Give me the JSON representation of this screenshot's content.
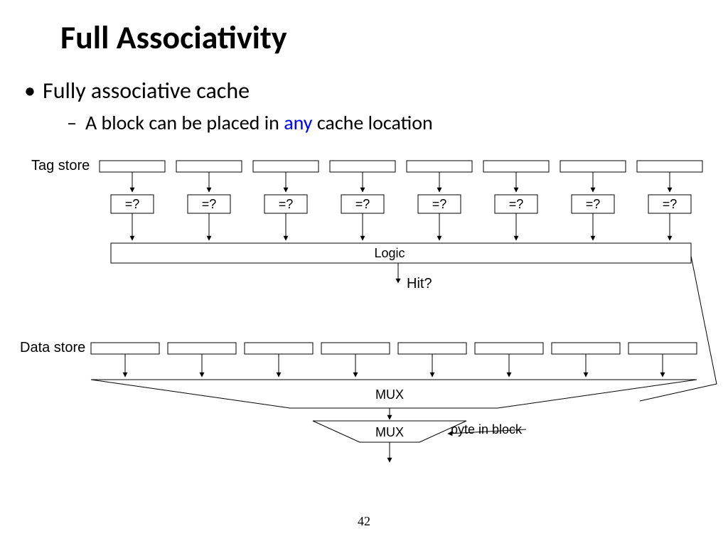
{
  "title": "Full Associativity",
  "bullet1": "Fully associative cache",
  "bullet2_pre": "A block can be placed in ",
  "bullet2_em": "any",
  "bullet2_post": " cache location",
  "labels": {
    "tag_store": "Tag store",
    "data_store": "Data store",
    "comparator": "=?",
    "logic": "Logic",
    "hit": "Hit?",
    "mux": "MUX",
    "byte_in_block": "byte in block"
  },
  "page_number": "42"
}
